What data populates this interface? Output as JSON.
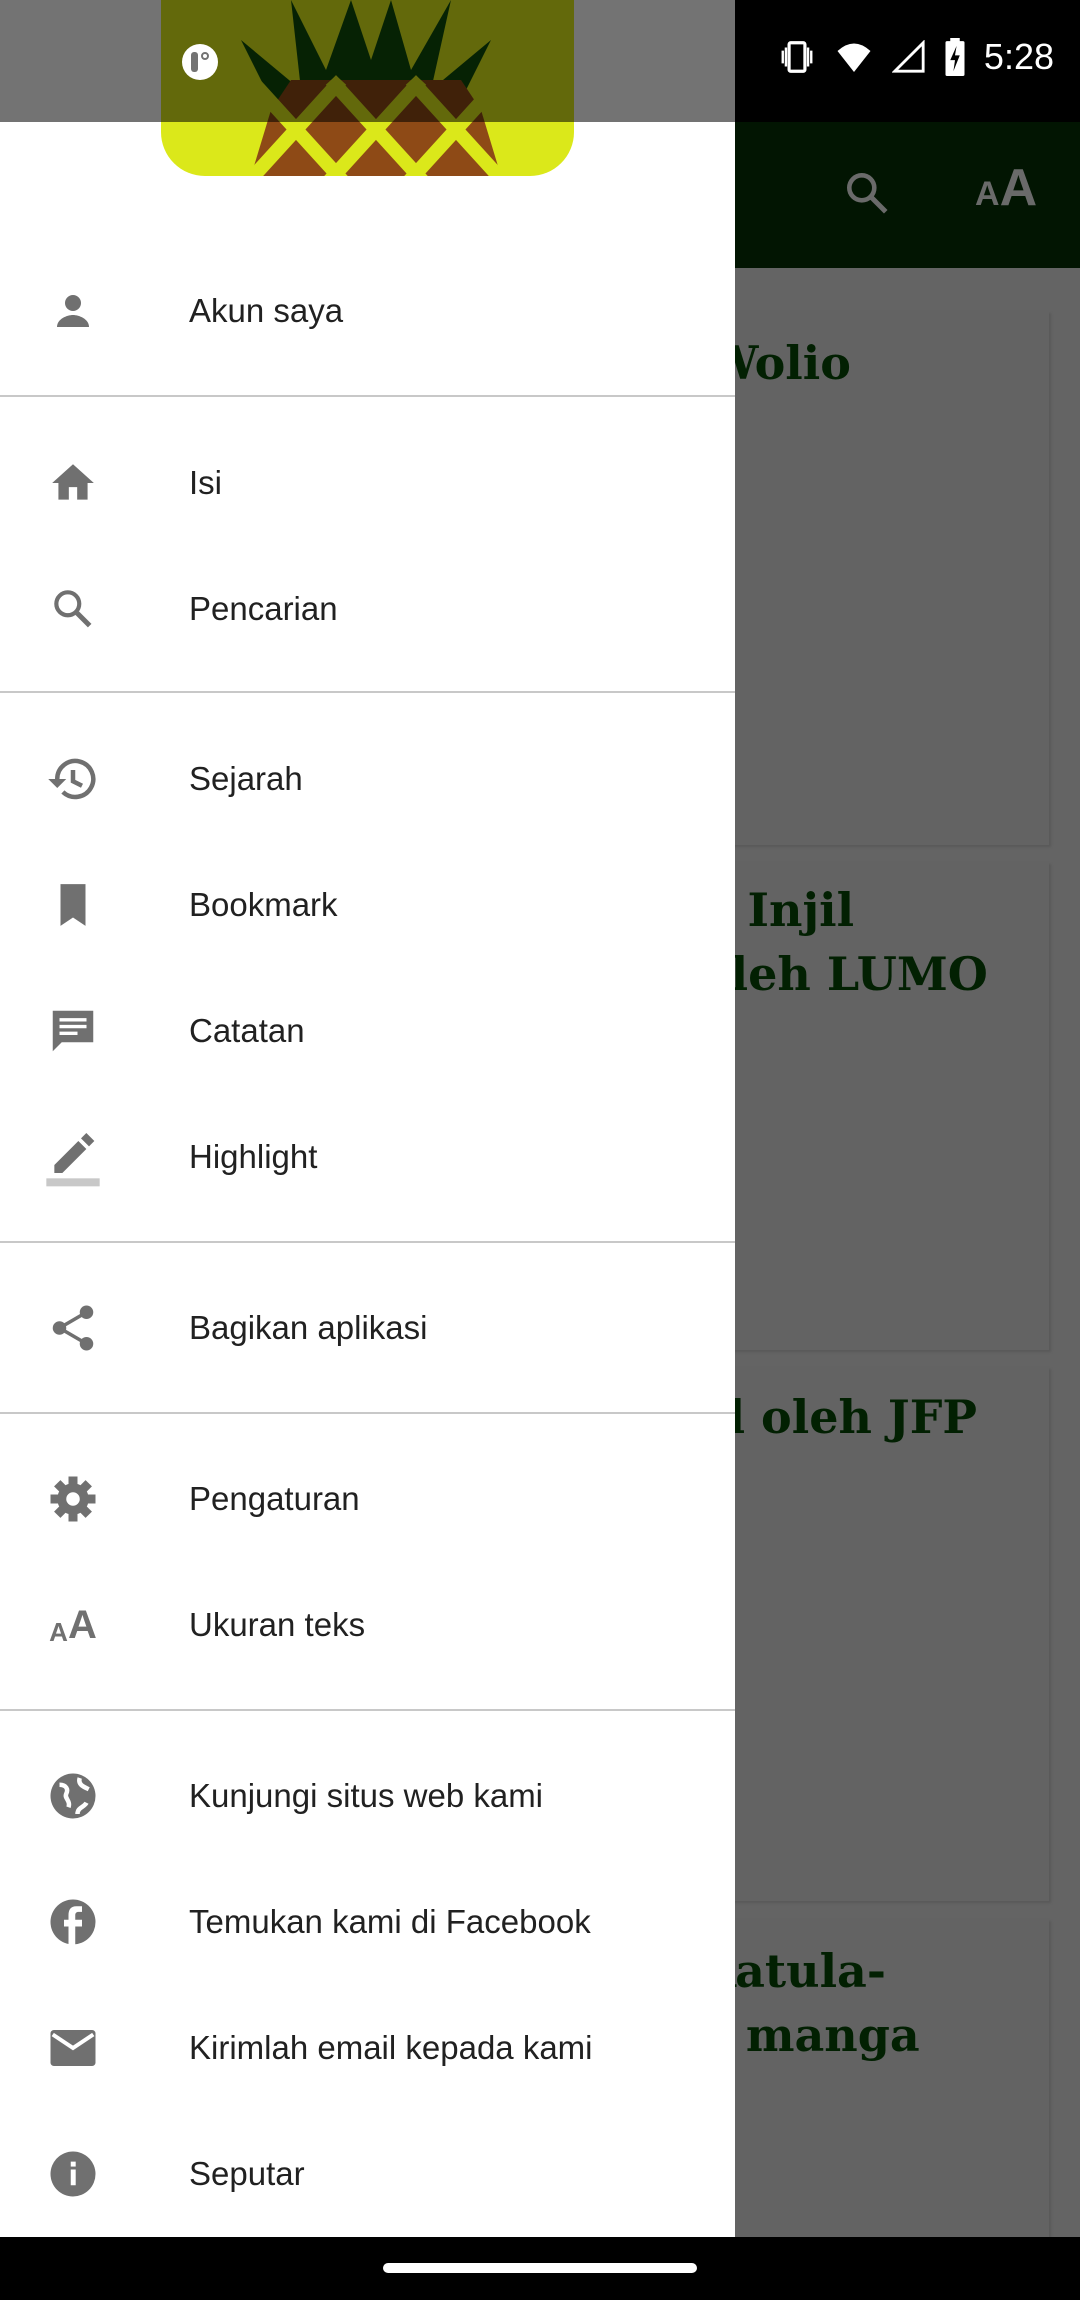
{
  "status_bar": {
    "time": "5:28",
    "icons": [
      "vibrate-icon",
      "wifi-icon",
      "signal-icon",
      "battery-charging-icon"
    ]
  },
  "toolbar": {
    "icons": [
      "search-icon",
      "text-size-icon"
    ]
  },
  "cards": [
    {
      "title": "o Wolio"
    },
    {
      "title": "ari Injil\noleh LUMO"
    },
    {
      "title": "njil oleh JFP"
    },
    {
      "title": "- Katula-\na manga"
    }
  ],
  "drawer": {
    "items": [
      {
        "label": "Akun saya",
        "icon": "person-icon"
      },
      {
        "label": "Isi",
        "icon": "home-icon"
      },
      {
        "label": "Pencarian",
        "icon": "search-icon"
      },
      {
        "label": "Sejarah",
        "icon": "history-icon"
      },
      {
        "label": "Bookmark",
        "icon": "bookmark-icon"
      },
      {
        "label": "Catatan",
        "icon": "note-icon"
      },
      {
        "label": "Highlight",
        "icon": "highlight-icon"
      },
      {
        "label": "Bagikan aplikasi",
        "icon": "share-icon"
      },
      {
        "label": "Pengaturan",
        "icon": "gear-icon"
      },
      {
        "label": "Ukuran teks",
        "icon": "text-size-icon"
      },
      {
        "label": "Kunjungi situs web kami",
        "icon": "globe-icon"
      },
      {
        "label": "Temukan kami di Facebook",
        "icon": "facebook-icon"
      },
      {
        "label": "Kirimlah email kepada kami",
        "icon": "email-icon"
      },
      {
        "label": "Seputar",
        "icon": "info-icon"
      }
    ]
  },
  "colors": {
    "toolbar": "#021502",
    "logo_bg": "#dbe81a",
    "icon": "#707070"
  }
}
